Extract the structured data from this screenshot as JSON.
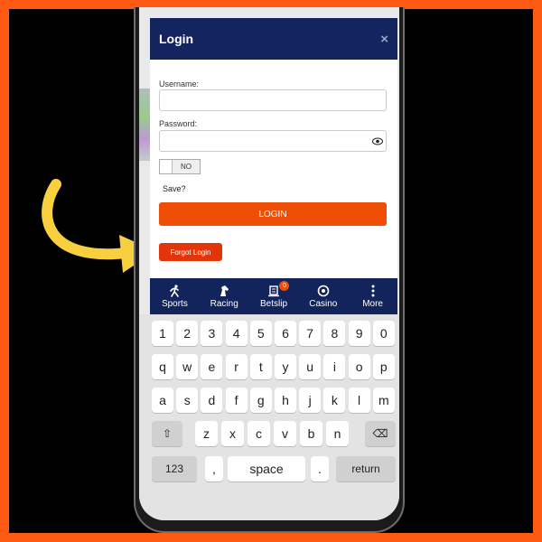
{
  "modal": {
    "title": "Login",
    "close_icon": "×",
    "username_label": "Username:",
    "username_value": "",
    "password_label": "Password:",
    "password_value": "",
    "toggle_text": "NO",
    "save_label": "Save?",
    "login_button": "LOGIN",
    "forgot_button": "Forgot Login"
  },
  "nav": {
    "items": [
      {
        "label": "Sports",
        "icon": "running-person-icon"
      },
      {
        "label": "Racing",
        "icon": "horse-head-icon"
      },
      {
        "label": "Betslip",
        "icon": "betslip-icon",
        "badge": "0"
      },
      {
        "label": "Casino",
        "icon": "casino-chip-icon"
      },
      {
        "label": "More",
        "icon": "vertical-dots-icon"
      }
    ]
  },
  "keyboard": {
    "row1": [
      "1",
      "2",
      "3",
      "4",
      "5",
      "6",
      "7",
      "8",
      "9",
      "0"
    ],
    "row2": [
      "q",
      "w",
      "e",
      "r",
      "t",
      "y",
      "u",
      "i",
      "o",
      "p"
    ],
    "row3": [
      "a",
      "s",
      "d",
      "f",
      "g",
      "h",
      "j",
      "k",
      "l",
      "m"
    ],
    "row4": [
      "z",
      "x",
      "c",
      "v",
      "b",
      "n"
    ],
    "shift_icon": "⇧",
    "backspace_icon": "⌫",
    "key_123": "123",
    "comma": ",",
    "space": "space",
    "period": ".",
    "return": "return"
  },
  "colors": {
    "accent": "#ef4e06",
    "navy": "#14245e",
    "border": "#ff5a14",
    "arrow": "#f7cf3f"
  }
}
